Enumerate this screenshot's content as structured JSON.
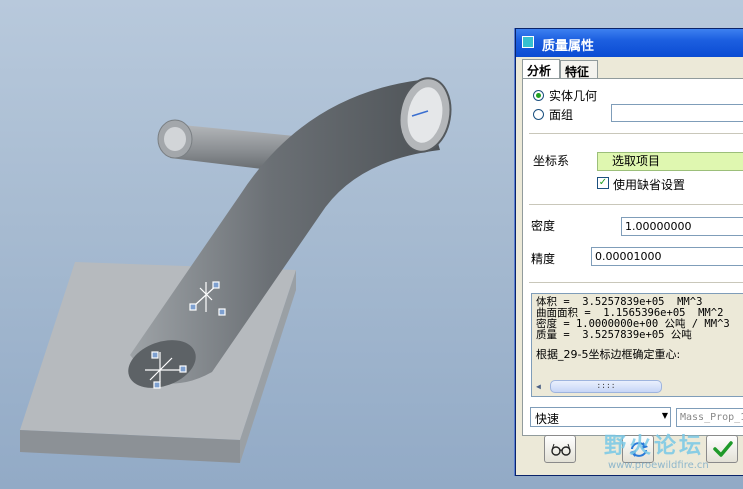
{
  "dialog": {
    "title": "质量属性",
    "tabs": [
      {
        "label": "分析",
        "active": true
      },
      {
        "label": "特征",
        "active": false
      }
    ],
    "geometry_options": [
      {
        "label": "实体几何",
        "selected": true
      },
      {
        "label": "面组",
        "selected": false
      }
    ],
    "coordinate_system": {
      "label": "坐标系",
      "select_value": "选取项目",
      "use_default_label": "使用缺省设置",
      "use_default_checked": true
    },
    "density": {
      "label": "密度",
      "value": "1.00000000"
    },
    "accuracy": {
      "label": "精度",
      "value": "0.00001000"
    },
    "results": {
      "lines": [
        "体积 =  3.5257839e+05  MM^3",
        "曲面面积 =  1.1565396e+05  MM^2",
        "密度 = 1.0000000e+00 公吨 / MM^3",
        "质量 =  3.5257839e+05 公吨"
      ],
      "note": "根据_29-5坐标边框确定重心:",
      "scroll_thumb": "::::"
    },
    "mode_select": "快速",
    "analysis_name": "Mass_Prop_1"
  },
  "watermark": {
    "text": "野火论坛",
    "url": "www.proewildfire.cn"
  },
  "colors": {
    "titlebar": "#0b4bd3",
    "dialog_bg": "#ece9d8",
    "field_green": "#dff7b0",
    "model_gray": "#6d7378"
  },
  "icons": {
    "eyeglasses": "eyeglasses-icon",
    "regenerate": "regenerate-icon",
    "ok": "checkmark-icon"
  }
}
